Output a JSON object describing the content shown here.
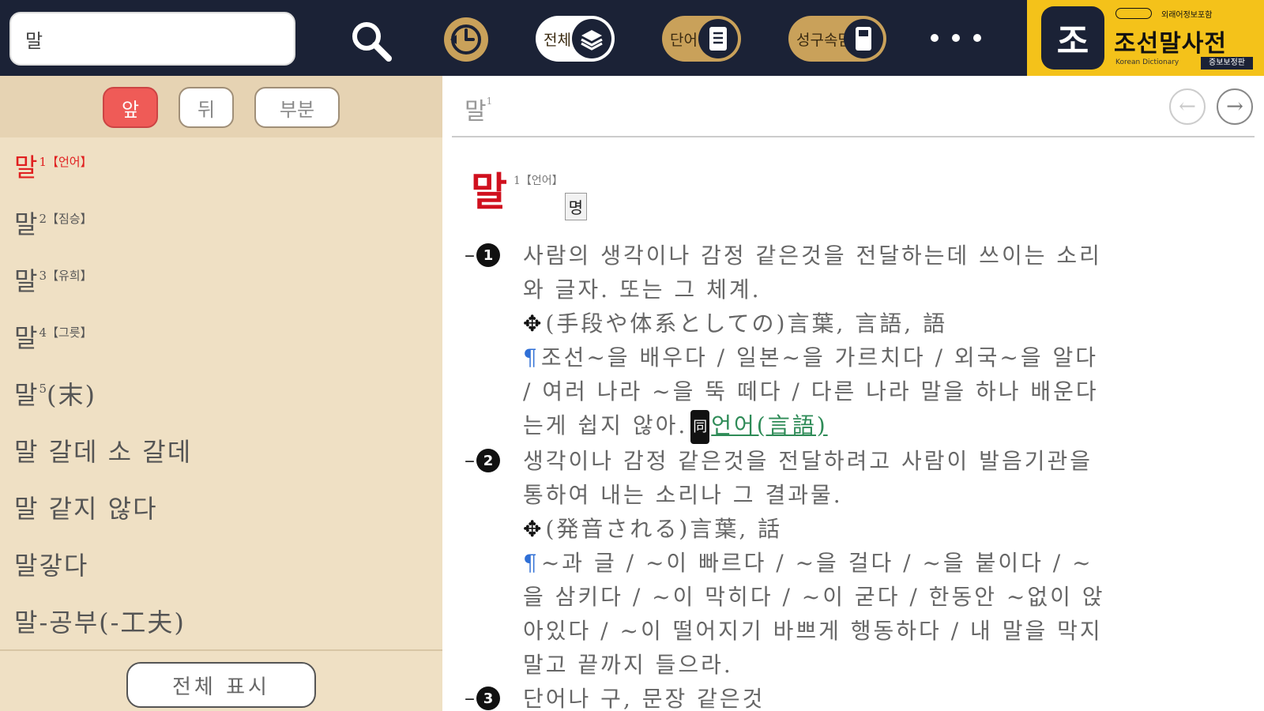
{
  "search": {
    "value": "말",
    "icons": {
      "search": "search-icon",
      "history": "clock-icon",
      "more": "more-icon"
    }
  },
  "toolbar": {
    "pill_all_label": "전체",
    "pill_word_label": "단어",
    "pill_idiom_label": "성구속담"
  },
  "brand": {
    "title": "조선말사전",
    "icon_glyph": "조",
    "top_text": "외래어정보포함",
    "subtitle": "Korean Dictionary",
    "edition": "증보보정판"
  },
  "filters": [
    {
      "label": "앞",
      "active": true
    },
    {
      "label": "뒤",
      "active": false
    },
    {
      "label": "부분",
      "active": false
    }
  ],
  "word_list": [
    {
      "word": "말",
      "sup": "1【언어】"
    },
    {
      "word": "말",
      "sup": "2【짐승】"
    },
    {
      "word": "말",
      "sup": "3【유희】"
    },
    {
      "word": "말",
      "sup": "4【그릇】"
    },
    {
      "word": "말",
      "sup": "5",
      "suffix": "(末)"
    },
    {
      "word": "말 갈데 소 갈데",
      "sup": ""
    },
    {
      "word": "말 같지 않다",
      "sup": ""
    },
    {
      "word": "말갛다",
      "sup": ""
    },
    {
      "word": "말-공부(-工夫)",
      "sup": ""
    }
  ],
  "show_all_label": "전체 표시",
  "entry": {
    "header_word": "말",
    "header_sup": "1",
    "headword": "말",
    "headword_sup": "1【언어】",
    "pos": "명",
    "sense1": {
      "num": "1",
      "def_line1": "사람의 생각이나 감정 같은것을 전달하는데 쓰이는 소리",
      "def_line2": "와 글자. 또는 그 체계.",
      "jp": "(手段や体系としての)言葉, 言語, 語",
      "ex_line1": "조선~을 배우다 / 일본~을 가르치다 / 외국~을 알다",
      "ex_line2": "/ 여러 나라 ~을 뚝 떼다 / 다른 나라 말을 하나 배운다",
      "ex_line3": "는게 쉽지 않아.",
      "syn_badge": "同",
      "syn_link": "언어(言語)"
    },
    "sense2": {
      "num": "2",
      "def_line1": "생각이나 감정 같은것을 전달하려고 사람이 발음기관을",
      "def_line2": "통하여 내는 소리나 그 결과물.",
      "jp": "(発音される)言葉, 話",
      "ex_line1": "~과 글 / ~이 빠르다 / ~을 걸다 / ~을 붙이다 / ~",
      "ex_line2": "을 삼키다 / ~이 막히다 / ~이 굳다 / 한동안 ~없이 앉",
      "ex_line3": "아있다 / ~이 떨어지기 바쁘게 행동하다 / 내 말을 막지",
      "ex_line4": "말고 끝까지 들으라."
    },
    "sense3": {
      "num": "3",
      "def_line1": "단어나 구, 문장 같은것"
    }
  }
}
